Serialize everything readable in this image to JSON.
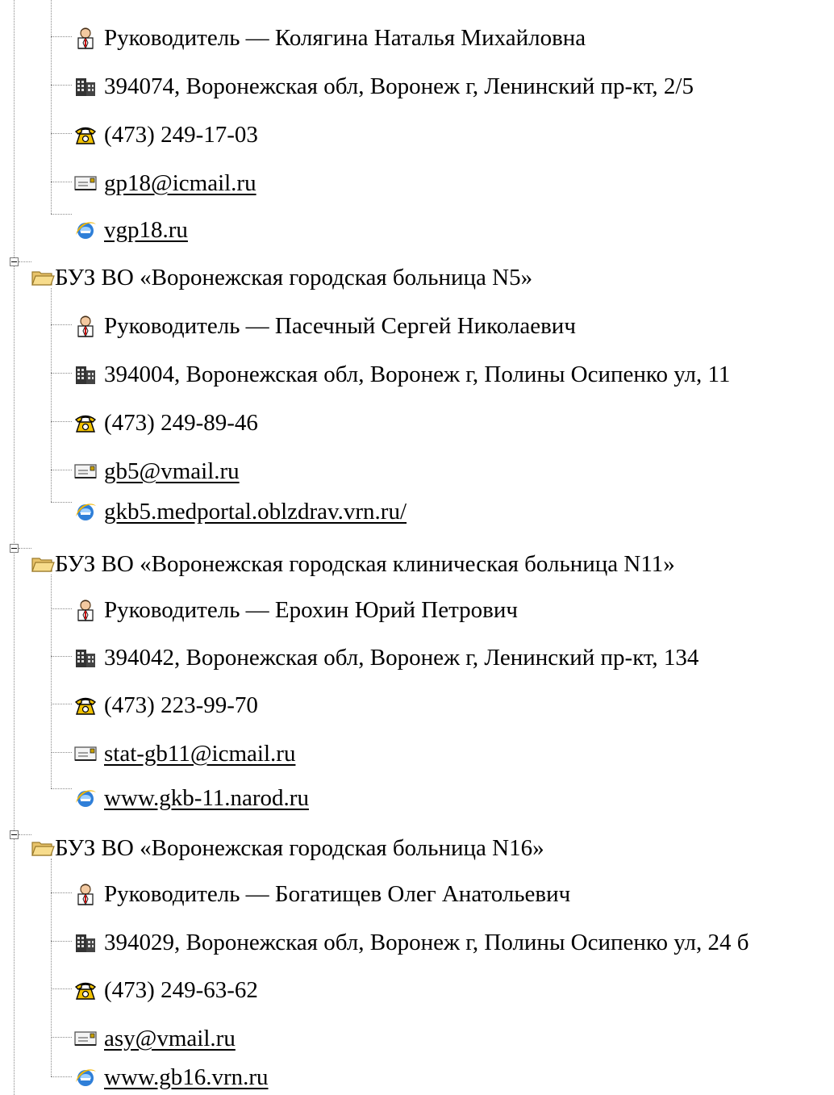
{
  "tree": {
    "first_block": {
      "head": "Руководитель — Колягина Наталья Михайловна",
      "address": "394074, Воронежская обл, Воронеж г, Ленинский пр-кт, 2/5",
      "phone": "(473) 249-17-03",
      "email": "gp18@icmail.ru",
      "site": "vgp18.ru"
    },
    "orgs": [
      {
        "name": "БУЗ ВО «Воронежская городская больница N5»",
        "head": "Руководитель — Пасечный Сергей Николаевич",
        "address": "394004, Воронежская обл, Воронеж г, Полины Осипенко ул, 11",
        "phone": "(473) 249-89-46",
        "email": "gb5@vmail.ru",
        "site": "gkb5.medportal.oblzdrav.vrn.ru/"
      },
      {
        "name": "БУЗ ВО «Воронежская городская клиническая больница N11»",
        "head": "Руководитель — Ерохин Юрий Петрович",
        "address": "394042, Воронежская обл, Воронеж г, Ленинский пр-кт, 134",
        "phone": "(473) 223-99-70",
        "email": "stat-gb11@icmail.ru",
        "site": "www.gkb-11.narod.ru"
      },
      {
        "name": "БУЗ ВО «Воронежская городская больница N16»",
        "head": "Руководитель — Богатищев Олег Анатольевич",
        "address": "394029, Воронежская обл, Воронеж г, Полины Осипенко ул, 24 б",
        "phone": "(473) 249-63-62",
        "email": "asy@vmail.ru",
        "site": "www.gb16.vrn.ru"
      }
    ]
  },
  "icons": {
    "person": "person-icon",
    "building": "building-icon",
    "phone": "phone-icon",
    "email": "envelope-icon",
    "site": "ie-globe-icon",
    "folder": "folder-open-icon",
    "expander": "collapse-box-icon"
  }
}
